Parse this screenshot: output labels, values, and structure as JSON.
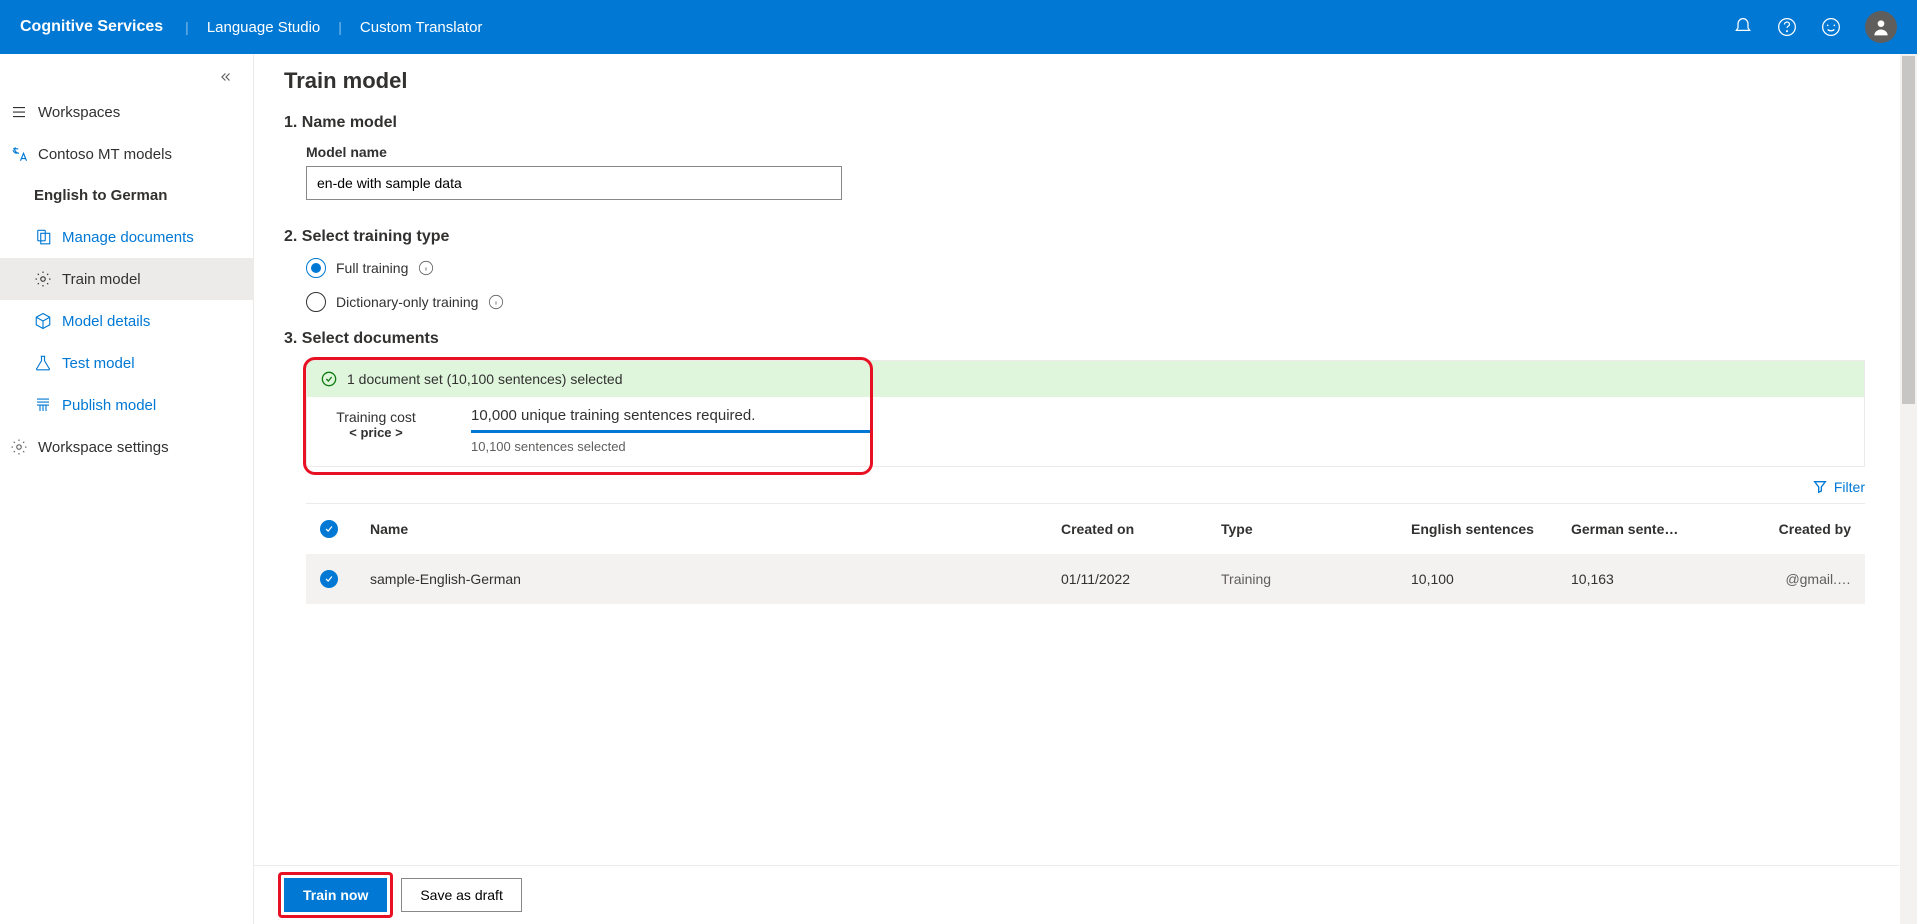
{
  "header": {
    "brand": "Cognitive Services",
    "crumb1": "Language Studio",
    "crumb2": "Custom Translator"
  },
  "sidebar": {
    "workspaces": "Workspaces",
    "project": "Contoso MT models",
    "pair": "English to German",
    "items": {
      "manage": "Manage documents",
      "train": "Train model",
      "details": "Model details",
      "test": "Test model",
      "publish": "Publish model"
    },
    "settings": "Workspace settings"
  },
  "page": {
    "title": "Train model",
    "step1": "1. Name model",
    "model_name_label": "Model name",
    "model_name_value": "en-de with sample data",
    "step2": "2. Select training type",
    "radio_full": "Full training",
    "radio_dict": "Dictionary-only training",
    "step3": "3. Select documents",
    "status_text": "1 document set (10,100 sentences) selected",
    "cost_label": "Training cost",
    "cost_price": "< price >",
    "required_text": "10,000 unique training sentences required.",
    "selected_text": "10,100 sentences selected",
    "filter": "Filter",
    "columns": {
      "name": "Name",
      "created": "Created on",
      "type": "Type",
      "eng": "English sentences",
      "ger": "German sente…",
      "by": "Created by"
    },
    "row": {
      "name": "sample-English-German",
      "created": "01/11/2022",
      "type": "Training",
      "eng": "10,100",
      "ger": "10,163",
      "by": "@gmail.…"
    },
    "train_btn": "Train now",
    "save_btn": "Save as draft"
  }
}
